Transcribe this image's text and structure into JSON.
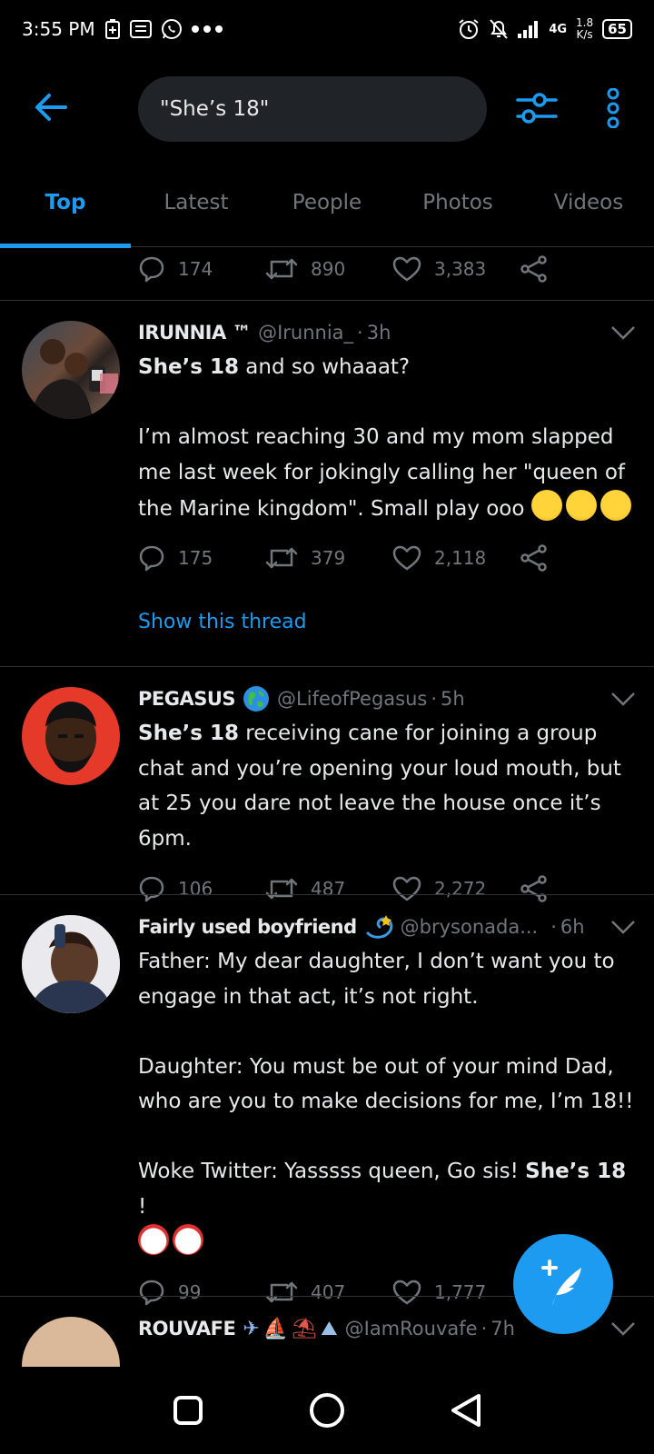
{
  "status_bar": {
    "time": "3:55 PM",
    "network": "4G",
    "speed_value": "1.8",
    "speed_unit": "K/s",
    "battery": "65"
  },
  "header": {
    "search_value": "\"She’s 18\""
  },
  "tabs": [
    {
      "label": "Top",
      "active": true
    },
    {
      "label": "Latest"
    },
    {
      "label": "People"
    },
    {
      "label": "Photos"
    },
    {
      "label": "Videos"
    }
  ],
  "prev_tweet": {
    "replies": "174",
    "retweets": "890",
    "likes": "3,383"
  },
  "tweets": [
    {
      "name": "IRUNNIA ™",
      "handle": "@Irunnia_",
      "time": "3h",
      "text_bold": "She’s 18",
      "text_rest": " and so whaaat?\n\nI’m almost reaching 30 and my mom slapped me last week for jokingly calling her \"queen of the Marine kingdom\". Small play ooo ",
      "replies": "175",
      "retweets": "379",
      "likes": "2,118",
      "show_thread": "Show this thread"
    },
    {
      "name": "PEGASUS",
      "handle": "@LifeofPegasus",
      "time": "5h",
      "text_bold": "She’s 18",
      "text_rest": " receiving cane for joining a group chat and you’re opening your loud mouth, but at 25 you dare not leave the house once it’s 6pm.",
      "replies": "106",
      "retweets": "487",
      "likes": "2,272"
    },
    {
      "name": "Fairly used boyfriend",
      "handle": "@brysonada...",
      "time": "6h",
      "text_pre": "Father: My dear daughter, I don’t want you to engage in that act, it’s not right.\n\nDaughter: You must be out of your mind Dad, who are you to make decisions for me, I’m 18!!\n\nWoke Twitter: Yasssss queen, Go sis! ",
      "text_bold": "She’s 18",
      "text_post": " !",
      "replies": "99",
      "retweets": "407",
      "likes": "1,777"
    },
    {
      "name": "ROUVAFE",
      "handle": "@IamRouvafe",
      "time": "7h"
    }
  ]
}
